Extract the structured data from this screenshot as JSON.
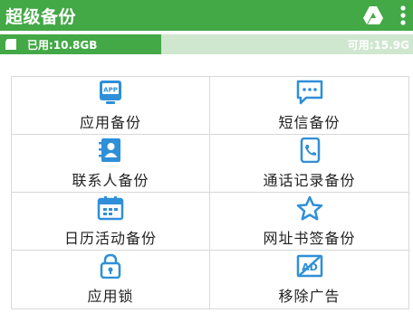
{
  "app_bar": {
    "title": "超级备份",
    "drive_icon": "google-drive-icon",
    "more_icon": "more-vertical-icon",
    "background": "#43a846"
  },
  "storage": {
    "used_label": "已用:10.8GB",
    "free_label": "可用:15.9G",
    "used_fraction": 0.39,
    "sd_icon": "sd-card-icon"
  },
  "grid": {
    "items": [
      {
        "label": "应用备份",
        "icon": "app-icon"
      },
      {
        "label": "短信备份",
        "icon": "sms-icon"
      },
      {
        "label": "联系人备份",
        "icon": "contacts-icon"
      },
      {
        "label": "通话记录备份",
        "icon": "call-log-icon"
      },
      {
        "label": "日历活动备份",
        "icon": "calendar-icon"
      },
      {
        "label": "网址书签备份",
        "icon": "bookmark-star-icon"
      },
      {
        "label": "应用锁",
        "icon": "lock-icon"
      },
      {
        "label": "移除广告",
        "icon": "remove-ads-icon"
      }
    ],
    "icon_color": "#2f8fd8"
  }
}
